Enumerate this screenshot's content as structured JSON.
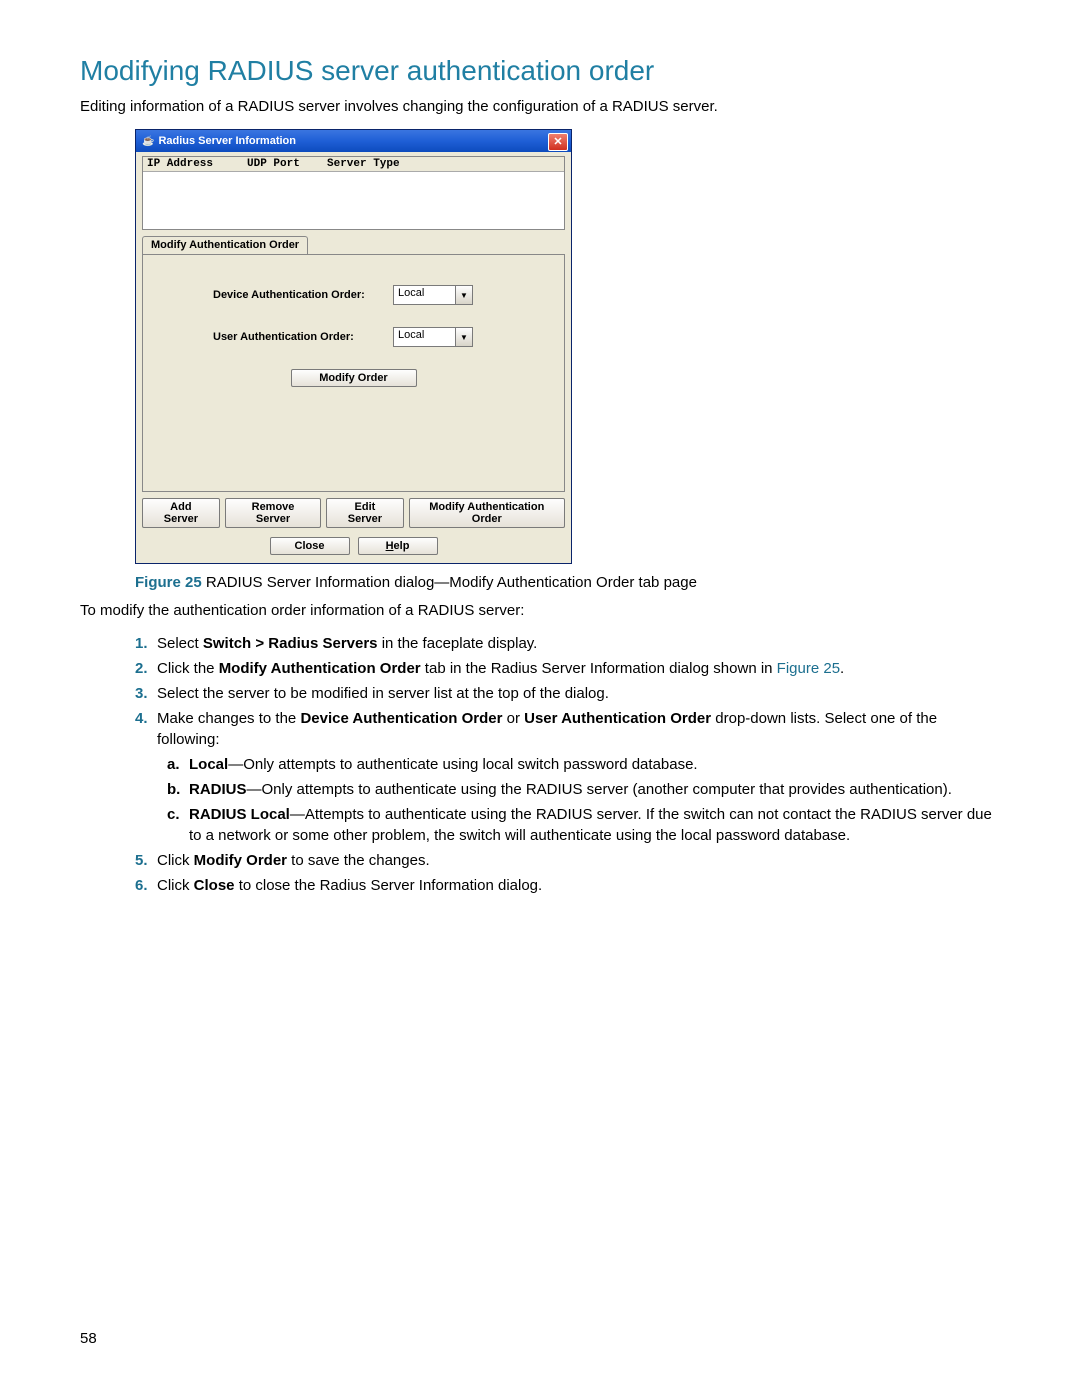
{
  "heading": "Modifying RADIUS server authentication order",
  "intro": "Editing information of a RADIUS server involves changing the configuration of a RADIUS server.",
  "dialog": {
    "title": "Radius Server Information",
    "cols": {
      "c1": "IP Address",
      "c2": "UDP Port",
      "c3": "Server Type"
    },
    "tab": "Modify Authentication Order",
    "row1label": "Device Authentication Order:",
    "row1value": "Local",
    "row2label": "User Authentication Order:",
    "row2value": "Local",
    "modifyBtn": "Modify Order",
    "addBtn": "Add Server",
    "removeBtn": "Remove Server",
    "editBtn": "Edit Server",
    "modTabBtn": "Modify Authentication Order",
    "closeBtn": "Close",
    "helpBtn": "Help"
  },
  "figcap": {
    "label": "Figure 25",
    "text": "  RADIUS Server Information dialog—Modify Authentication Order tab page"
  },
  "lead": "To modify the authentication order information of a RADIUS server:",
  "steps": {
    "s1a": "Select ",
    "s1b": "Switch > Radius Servers",
    "s1c": " in the faceplate display.",
    "s2a": "Click the ",
    "s2b": "Modify Authentication Order",
    "s2c": " tab in the Radius Server Information dialog shown in ",
    "s2d": "Figure 25",
    "s2e": ".",
    "s3": "Select the server to be modified in server list at the top of the dialog.",
    "s4a": "Make changes to the ",
    "s4b": "Device Authentication Order",
    "s4c": " or ",
    "s4d": "User Authentication Order",
    "s4e": " drop-down lists. Select one of the following:",
    "sub_a_b": "Local",
    "sub_a_t": "—Only attempts to authenticate using local switch password database.",
    "sub_b_b": "RADIUS",
    "sub_b_t": "—Only attempts to authenticate using the RADIUS server (another computer that provides authentication).",
    "sub_c_b": "RADIUS Local",
    "sub_c_t": "—Attempts to authenticate using the RADIUS server. If the switch can not contact the RADIUS server due to a network or some other problem, the switch will authenticate using the local password database.",
    "s5a": "Click ",
    "s5b": "Modify Order",
    "s5c": " to save the changes.",
    "s6a": "Click ",
    "s6b": "Close",
    "s6c": " to close the Radius Server Information dialog."
  },
  "pagenum": "58"
}
